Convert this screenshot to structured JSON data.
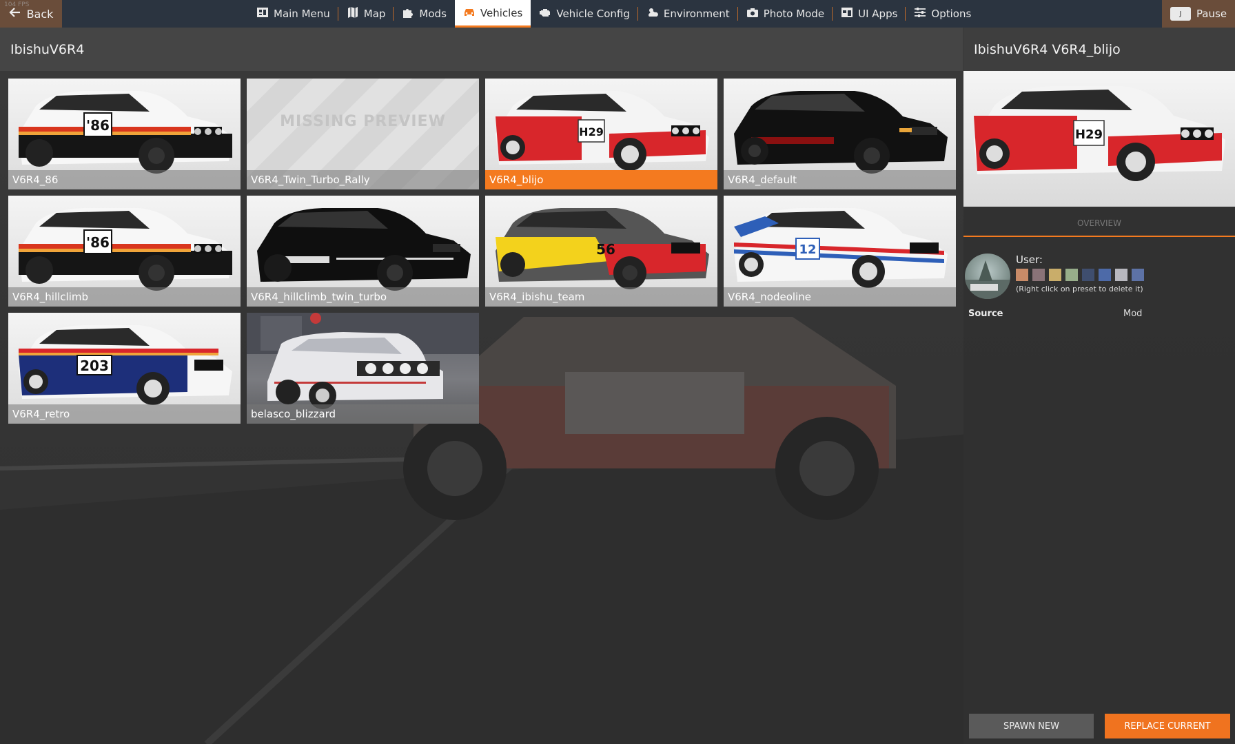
{
  "fps_text": "104 FPS",
  "topbar": {
    "back_label": "Back",
    "nav": [
      {
        "label": "Main Menu",
        "icon": "main-menu-icon"
      },
      {
        "label": "Map",
        "icon": "map-icon"
      },
      {
        "label": "Mods",
        "icon": "puzzle-icon"
      },
      {
        "label": "Vehicles",
        "icon": "car-icon",
        "active": true
      },
      {
        "label": "Vehicle Config",
        "icon": "engine-icon"
      },
      {
        "label": "Environment",
        "icon": "weather-icon"
      },
      {
        "label": "Photo Mode",
        "icon": "camera-icon"
      },
      {
        "label": "UI Apps",
        "icon": "apps-icon"
      },
      {
        "label": "Options",
        "icon": "sliders-icon"
      }
    ],
    "pause_key": "J",
    "pause_label": "Pause"
  },
  "grid": {
    "title": "IbishuV6R4",
    "missing_preview_text": "MISSING PREVIEW",
    "tiles": [
      {
        "label": "V6R4_86",
        "number": "'86"
      },
      {
        "label": "V6R4_Twin_Turbo_Rally",
        "missing": true
      },
      {
        "label": "V6R4_blijo",
        "number": "H29",
        "selected": true
      },
      {
        "label": "V6R4_default"
      },
      {
        "label": "V6R4_hillclimb",
        "number": "'86"
      },
      {
        "label": "V6R4_hillclimb_twin_turbo"
      },
      {
        "label": "V6R4_ibishu_team",
        "number": "56"
      },
      {
        "label": "V6R4_nodeoline",
        "number": "12"
      },
      {
        "label": "V6R4_retro",
        "number": "203"
      },
      {
        "label": "belasco_blizzard"
      }
    ]
  },
  "details": {
    "title": "IbishuV6R4 V6R4_blijo",
    "preview_number": "H29",
    "overview_tab": "OVERVIEW",
    "user_label": "User:",
    "swatches": [
      "#c98b68",
      "#8a7378",
      "#c9ad6a",
      "#97ad8a",
      "#3f4e6e",
      "#4d6aa8",
      "#b8b8bf",
      "#5d72a6"
    ],
    "delete_hint": "(Right click on preset to delete it)",
    "source_label": "Source",
    "source_value": "Mod"
  },
  "actions": {
    "spawn_new": "SPAWN NEW",
    "replace_current": "REPLACE CURRENT"
  },
  "colors": {
    "accent": "#f47a1f",
    "topbar": "#2b3440",
    "back_button": "#6a4d3a"
  }
}
